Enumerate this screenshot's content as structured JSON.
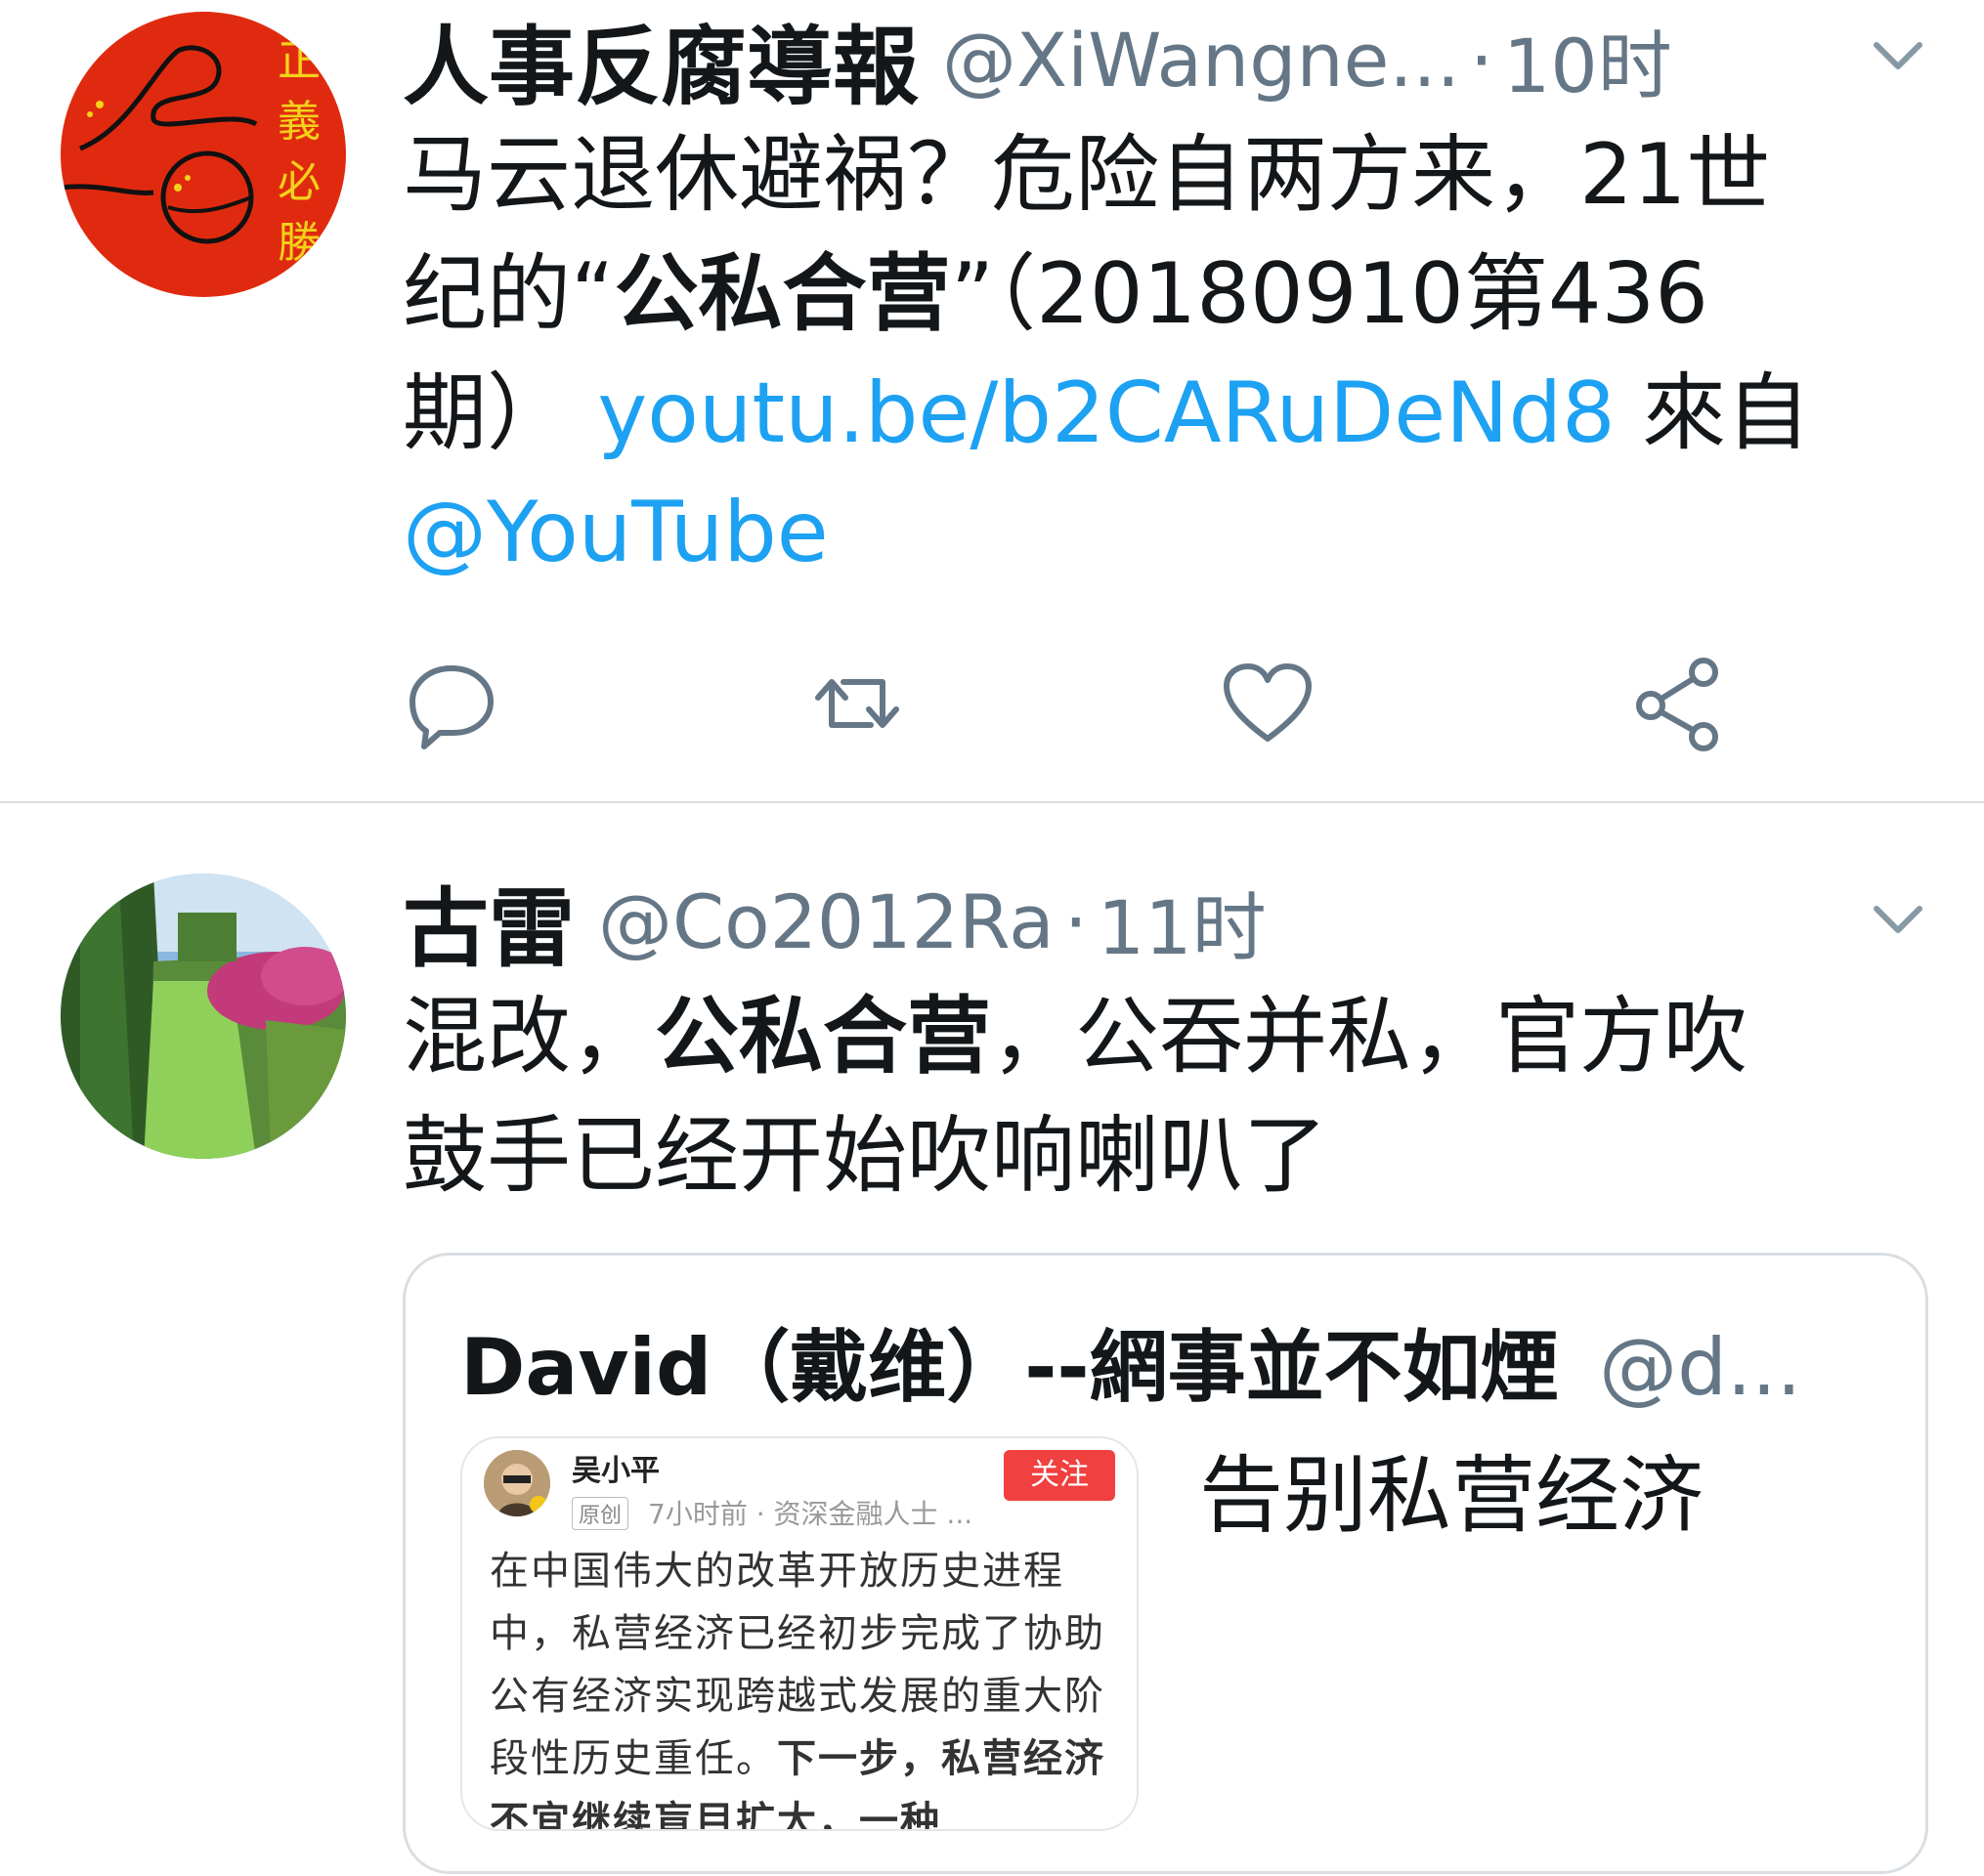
{
  "tweets": [
    {
      "display_name": "人事反腐導報",
      "handle": "@XiWangne...",
      "separator": "·",
      "time": "10时",
      "text": {
        "line1": "马云退休避祸？危险自两方来，21世",
        "line2_a": "纪的“",
        "line2_bold": "公私合营",
        "line2_b": "”（20180910第436",
        "line3_a": "期） ",
        "link": "youtu.be/b2CARuDeNd8",
        "line3_b": " 來自",
        "mention": "@YouTube"
      },
      "avatar": {
        "bg_color": "#e02a0f",
        "chars": [
          "正",
          "義",
          "必",
          "勝"
        ],
        "char_color": "#f3d21a"
      },
      "actions": [
        "reply-icon",
        "retweet-icon",
        "like-icon",
        "share-icon"
      ]
    },
    {
      "display_name": "古雷",
      "handle": "@Co2012Ra",
      "separator": "·",
      "time": "11时",
      "text": {
        "line1_a": "混改，",
        "line1_bold": "公私合营",
        "line1_b": "，公吞并私，官方吹",
        "line2": "鼓手已经开始吹响喇叭了"
      },
      "quote": {
        "display_name": "David（戴维）--網事並不如煙",
        "handle": "@d...",
        "text": "告别私营经济",
        "card": {
          "author": "吴小平",
          "follow_label": "关注",
          "badge": "原创",
          "meta": "7小时前 · 资深金融人士 ...",
          "body_plain": "在中国伟大的改革开放历史进程中，私营经济已经初步完成了协助公有经济实现跨越式发展的重大阶段性历史重任。",
          "body_bold": "下一步，私营经济不宜继续盲目扩大，一种"
        }
      }
    }
  ],
  "colors": {
    "link": "#1da1f2",
    "secondary_text": "#657786",
    "icon": "#657786",
    "divider": "#d8dde2"
  }
}
